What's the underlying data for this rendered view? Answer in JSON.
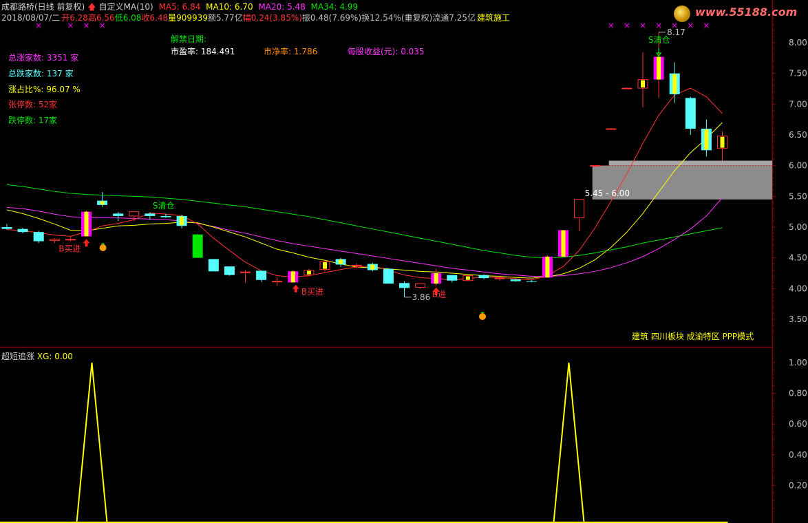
{
  "header": {
    "title": "成都路桥(日线 前复权)",
    "custom_ma": "自定义MA(10)",
    "ma5": "MA5: 6.84",
    "ma10": "MA10: 6.70",
    "ma20": "MA20: 5.48",
    "ma34": "MA34: 4.99",
    "date": "2018/08/07/二",
    "open": "开6.28",
    "high": "高6.56",
    "low": "低6.08",
    "close": "收6.48",
    "volume": "量909939",
    "amount": "额5.77亿",
    "change": "幅0.24(3.85%)",
    "amplitude": "振0.48(7.69%)",
    "turnover": "换12.54%(重复权)",
    "float": "流通7.25亿",
    "industry": "建筑施工"
  },
  "stats": {
    "up_total": "总涨家数: 3351 家",
    "down_total": "总跌家数: 137 家",
    "up_ratio": "涨占比%: 96.07 %",
    "limit_up": "张停数: 52家",
    "limit_down": "跌停数: 17家"
  },
  "fundamentals": {
    "unlock_label": "解禁日期:",
    "pe": "市盈率: 184.491",
    "pb": "市净率: 1.786",
    "eps": "每股收益(元): 0.035"
  },
  "concept_tags": "建筑 四川板块 成渝特区 PPP模式",
  "indicator": {
    "label": "超短追涨",
    "xg": "XG: 0.00"
  },
  "logo_text": "www.55188.com",
  "annotations": {
    "buy1": "B买进",
    "buy2": "B买进",
    "buy3": "B进",
    "sell1": "S清仓",
    "sell2": "S清仓",
    "low_price": "3.86",
    "high_price": "8.17",
    "box_range": "5.45 - 6.00"
  },
  "colors": {
    "up": "#ff3232",
    "down": "#54fcfc",
    "ma5": "#ff3232",
    "ma10": "#ffff00",
    "ma20": "#ff32ff",
    "ma34": "#00e600",
    "signal": "#ff00ff",
    "xg": "#ffff00",
    "grid": "#8b0000"
  },
  "chart_data": [
    {
      "type": "candlestick",
      "y_axis_ticks": [
        "8.00",
        "7.50",
        "7.00",
        "6.50",
        "6.00",
        "5.50",
        "5.00",
        "4.50",
        "4.00",
        "3.50"
      ],
      "ylim": [
        3.25,
        8.55
      ],
      "candles": [
        {
          "o": 5.0,
          "h": 5.05,
          "l": 4.96,
          "c": 4.97
        },
        {
          "o": 4.97,
          "h": 4.99,
          "l": 4.9,
          "c": 4.92
        },
        {
          "o": 4.92,
          "h": 4.94,
          "l": 4.74,
          "c": 4.77
        },
        {
          "o": 4.78,
          "h": 4.82,
          "l": 4.74,
          "c": 4.8
        },
        {
          "o": 4.8,
          "h": 4.84,
          "l": 4.77,
          "c": 4.8
        },
        {
          "o": 4.85,
          "h": 5.27,
          "l": 4.85,
          "c": 5.25,
          "sig": true
        },
        {
          "o": 5.43,
          "h": 5.57,
          "l": 5.33,
          "c": 5.36
        },
        {
          "o": 5.22,
          "h": 5.25,
          "l": 5.1,
          "c": 5.18
        },
        {
          "o": 5.18,
          "h": 5.25,
          "l": 5.1,
          "c": 5.25
        },
        {
          "o": 5.22,
          "h": 5.24,
          "l": 5.12,
          "c": 5.18
        },
        {
          "o": 5.18,
          "h": 5.22,
          "l": 5.15,
          "c": 5.16
        },
        {
          "o": 5.18,
          "h": 5.2,
          "l": 4.98,
          "c": 5.02
        },
        {
          "o": 4.88,
          "h": 4.89,
          "l": 4.5,
          "c": 4.5,
          "dropgreen": true
        },
        {
          "o": 4.48,
          "h": 4.48,
          "l": 4.28,
          "c": 4.28
        },
        {
          "o": 4.36,
          "h": 4.36,
          "l": 4.21,
          "c": 4.22
        },
        {
          "o": 4.26,
          "h": 4.3,
          "l": 4.1,
          "c": 4.27
        },
        {
          "o": 4.29,
          "h": 4.29,
          "l": 4.11,
          "c": 4.14
        },
        {
          "o": 4.12,
          "h": 4.18,
          "l": 4.04,
          "c": 4.12
        },
        {
          "o": 4.1,
          "h": 4.3,
          "l": 4.1,
          "c": 4.28,
          "sig": true
        },
        {
          "o": 4.22,
          "h": 4.32,
          "l": 4.2,
          "c": 4.3
        },
        {
          "o": 4.31,
          "h": 4.46,
          "l": 4.28,
          "c": 4.44
        },
        {
          "o": 4.48,
          "h": 4.5,
          "l": 4.35,
          "c": 4.39
        },
        {
          "o": 4.38,
          "h": 4.41,
          "l": 4.33,
          "c": 4.38
        },
        {
          "o": 4.4,
          "h": 4.42,
          "l": 4.28,
          "c": 4.3
        },
        {
          "o": 4.32,
          "h": 4.33,
          "l": 4.08,
          "c": 4.08
        },
        {
          "o": 4.09,
          "h": 4.12,
          "l": 3.86,
          "c": 4.01
        },
        {
          "o": 4.02,
          "h": 4.09,
          "l": 4.0,
          "c": 4.08
        },
        {
          "o": 4.08,
          "h": 4.32,
          "l": 4.05,
          "c": 4.25,
          "sig": true
        },
        {
          "o": 4.22,
          "h": 4.22,
          "l": 4.1,
          "c": 4.13
        },
        {
          "o": 4.13,
          "h": 4.21,
          "l": 4.12,
          "c": 4.21
        },
        {
          "o": 4.22,
          "h": 4.23,
          "l": 4.15,
          "c": 4.17
        },
        {
          "o": 4.17,
          "h": 4.21,
          "l": 4.13,
          "c": 4.17
        },
        {
          "o": 4.15,
          "h": 4.16,
          "l": 4.11,
          "c": 4.12
        },
        {
          "o": 4.12,
          "h": 4.14,
          "l": 4.1,
          "c": 4.11
        },
        {
          "o": 4.18,
          "h": 4.54,
          "l": 4.18,
          "c": 4.52,
          "sig": true
        },
        {
          "o": 4.52,
          "h": 4.95,
          "l": 4.52,
          "c": 4.95,
          "sig": true
        },
        {
          "o": 5.15,
          "h": 5.45,
          "l": 4.93,
          "c": 5.45
        },
        {
          "o": 5.99,
          "h": 6.01,
          "l": 5.99,
          "c": 6.0
        },
        {
          "o": 6.6,
          "h": 6.61,
          "l": 6.59,
          "c": 6.6
        },
        {
          "o": 7.26,
          "h": 7.27,
          "l": 7.25,
          "c": 7.26
        },
        {
          "o": 7.26,
          "h": 7.84,
          "l": 6.95,
          "c": 7.4
        },
        {
          "o": 7.4,
          "h": 8.17,
          "l": 7.1,
          "c": 7.77,
          "sig": true
        },
        {
          "o": 7.5,
          "h": 7.68,
          "l": 7.02,
          "c": 7.16
        },
        {
          "o": 7.1,
          "h": 7.12,
          "l": 6.5,
          "c": 6.6
        },
        {
          "o": 6.6,
          "h": 6.75,
          "l": 6.15,
          "c": 6.25
        },
        {
          "o": 6.28,
          "h": 6.56,
          "l": 6.08,
          "c": 6.48
        }
      ],
      "ma5": [
        4.96,
        4.94,
        4.91,
        4.87,
        4.85,
        4.92,
        5.02,
        5.06,
        5.12,
        5.23,
        5.21,
        5.19,
        5.05,
        4.82,
        4.62,
        4.43,
        4.29,
        4.21,
        4.19,
        4.21,
        4.26,
        4.31,
        4.35,
        4.37,
        4.3,
        4.22,
        4.18,
        4.16,
        4.14,
        4.16,
        4.19,
        4.18,
        4.16,
        4.14,
        4.21,
        4.36,
        4.62,
        4.99,
        5.42,
        5.87,
        6.36,
        6.82,
        7.15,
        7.26,
        7.12,
        6.85
      ],
      "ma10": [
        5.28,
        5.22,
        5.14,
        5.05,
        4.95,
        4.94,
        4.98,
        5.02,
        5.03,
        5.05,
        5.06,
        5.08,
        5.07,
        5.0,
        4.92,
        4.84,
        4.74,
        4.64,
        4.58,
        4.51,
        4.46,
        4.4,
        4.35,
        4.34,
        4.32,
        4.3,
        4.28,
        4.27,
        4.25,
        4.23,
        4.21,
        4.2,
        4.18,
        4.17,
        4.19,
        4.24,
        4.33,
        4.47,
        4.67,
        4.92,
        5.22,
        5.57,
        5.92,
        6.21,
        6.44,
        6.7
      ],
      "ma20": [
        5.32,
        5.3,
        5.26,
        5.21,
        5.17,
        5.15,
        5.15,
        5.15,
        5.14,
        5.13,
        5.12,
        5.1,
        5.06,
        5.01,
        4.95,
        4.9,
        4.84,
        4.78,
        4.73,
        4.69,
        4.65,
        4.61,
        4.57,
        4.53,
        4.49,
        4.45,
        4.41,
        4.37,
        4.33,
        4.3,
        4.27,
        4.24,
        4.22,
        4.2,
        4.2,
        4.21,
        4.24,
        4.28,
        4.34,
        4.42,
        4.52,
        4.65,
        4.8,
        4.97,
        5.18,
        5.48
      ],
      "ma34": [
        5.69,
        5.66,
        5.62,
        5.58,
        5.55,
        5.53,
        5.52,
        5.51,
        5.5,
        5.49,
        5.47,
        5.45,
        5.42,
        5.39,
        5.36,
        5.33,
        5.29,
        5.25,
        5.21,
        5.17,
        5.12,
        5.07,
        5.02,
        4.97,
        4.92,
        4.87,
        4.82,
        4.77,
        4.72,
        4.67,
        4.62,
        4.58,
        4.54,
        4.51,
        4.5,
        4.51,
        4.54,
        4.58,
        4.63,
        4.68,
        4.74,
        4.79,
        4.84,
        4.89,
        4.94,
        4.99
      ],
      "box": {
        "low": 5.45,
        "high": 6.0
      },
      "top_markers_candles": [
        2,
        4,
        5,
        6,
        38,
        39,
        40,
        41,
        42,
        43,
        44
      ]
    },
    {
      "type": "line",
      "title": "超短追涨",
      "y_axis_ticks": [
        "1.00",
        "0.80",
        "0.60",
        "0.40",
        "0.20"
      ],
      "ylim": [
        0,
        1.05
      ],
      "xg": [
        0,
        0,
        0,
        0,
        0,
        1,
        0,
        0,
        0,
        0,
        0,
        0,
        0,
        0,
        0,
        0,
        0,
        0,
        0,
        0,
        0,
        0,
        0,
        0,
        0,
        0,
        0,
        0,
        0,
        0,
        0,
        0,
        0,
        0,
        0,
        1,
        0,
        0,
        0,
        0,
        0,
        0,
        0,
        0,
        0,
        0
      ]
    }
  ]
}
